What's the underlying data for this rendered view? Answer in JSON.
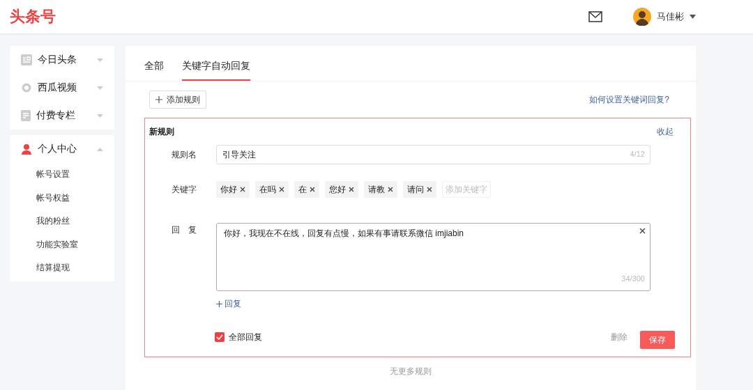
{
  "header": {
    "logo": "头条号",
    "user_name": "马佳彬"
  },
  "sidebar": {
    "groups": [
      {
        "items": [
          {
            "label": "今日头条",
            "kind": "news",
            "expanded": false
          },
          {
            "label": "西瓜视频",
            "kind": "video",
            "expanded": false
          },
          {
            "label": "付费专栏",
            "kind": "column",
            "expanded": false
          }
        ]
      },
      {
        "items": [
          {
            "label": "个人中心",
            "kind": "person",
            "expanded": true,
            "children": [
              {
                "label": "帐号设置"
              },
              {
                "label": "帐号权益"
              },
              {
                "label": "我的粉丝"
              },
              {
                "label": "功能实验室"
              },
              {
                "label": "结算提现"
              }
            ]
          }
        ]
      }
    ]
  },
  "tabs": [
    {
      "label": "全部",
      "selected": false
    },
    {
      "label": "关键字自动回复",
      "selected": true
    }
  ],
  "add_rule_button": "添加规则",
  "help_link": "如何设置关键词回复?",
  "rule": {
    "title": "新规则",
    "collapse_link": "收起",
    "name_label": "规则名",
    "name_value": "引导关注",
    "name_count": "4/12",
    "keywords_label": "关键字",
    "keywords": [
      "你好",
      "在吗",
      "在",
      "您好",
      "请教",
      "请问"
    ],
    "keyword_placeholder": "添加关键字",
    "reply_label": "回　复",
    "reply_value": "你好，我现在不在线，回复有点慢，如果有事请联系微信 imjiabin",
    "reply_count": "34/300",
    "add_reply": "回复",
    "reply_all": {
      "label": "全部回复",
      "checked": true
    },
    "delete_button": "删除",
    "save_button": "保存"
  },
  "footer_note": "无更多规则"
}
